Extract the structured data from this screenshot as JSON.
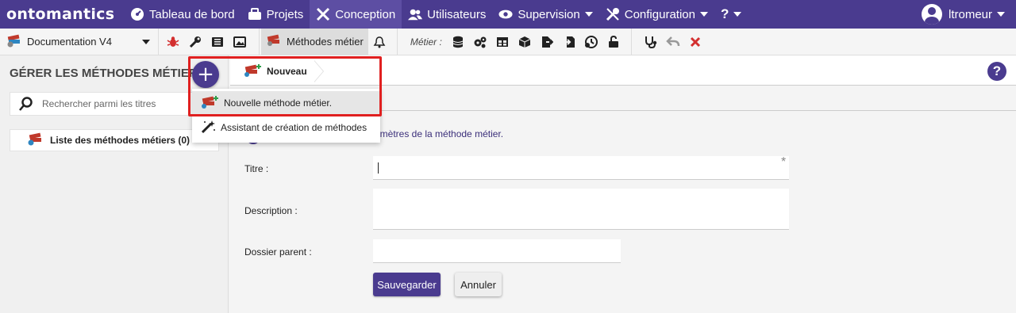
{
  "nav": {
    "logo": "ontomantics",
    "items": [
      {
        "label": "Tableau de bord",
        "icon": "dashboard-icon"
      },
      {
        "label": "Projets",
        "icon": "projects-icon"
      },
      {
        "label": "Conception",
        "icon": "design-tools-icon"
      },
      {
        "label": "Utilisateurs",
        "icon": "users-icon"
      },
      {
        "label": "Supervision",
        "icon": "eye-icon"
      },
      {
        "label": "Configuration",
        "icon": "tools-icon"
      },
      {
        "label": "?",
        "icon": "help-menu-icon"
      }
    ],
    "user": "ltromeur"
  },
  "toolbar": {
    "project": "Documentation V4",
    "methodes_label": "Méthodes métier",
    "metier_label": "Métier :"
  },
  "left": {
    "title": "GÉRER LES MÉTHODES MÉTIER",
    "search_placeholder": "Rechercher parmi les titres",
    "list_label": "Liste des méthodes métiers (0)"
  },
  "dropdown": {
    "items": [
      {
        "label": "Nouvelle méthode métier."
      },
      {
        "label": "Assistant de création de méthodes"
      }
    ]
  },
  "content": {
    "tab_label": "Nouveau",
    "info_text": "ramètres de la méthode métier.",
    "fields": {
      "titre_label": "Titre :",
      "titre_value": "",
      "description_label": "Description :",
      "description_value": "",
      "dossier_label": "Dossier parent :",
      "dossier_value": ""
    },
    "required_mark": "*",
    "save_label": "Sauvegarder",
    "cancel_label": "Annuler"
  },
  "colors": {
    "primary": "#4a3b8f",
    "highlight": "#e02020",
    "bug_red": "#d32f2f",
    "close_red": "#d32f2f"
  }
}
